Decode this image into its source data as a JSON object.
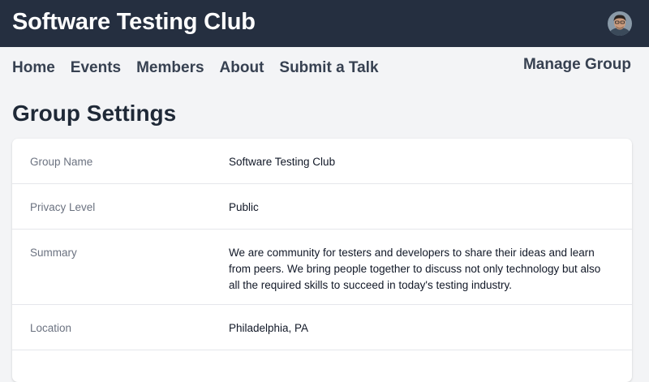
{
  "header": {
    "title": "Software Testing Club",
    "avatar_icon": "user-avatar",
    "background_color": "#252f40"
  },
  "nav": {
    "items": [
      {
        "label": "Home"
      },
      {
        "label": "Events"
      },
      {
        "label": "Members"
      },
      {
        "label": "About"
      },
      {
        "label": "Submit a Talk"
      }
    ],
    "manage_label": "Manage Group"
  },
  "page": {
    "title": "Group Settings"
  },
  "settings": {
    "rows": [
      {
        "label": "Group Name",
        "value": "Software Testing Club"
      },
      {
        "label": "Privacy Level",
        "value": "Public"
      },
      {
        "label": "Summary",
        "value": "We are community for testers and developers to share their ideas and learn from peers. We bring people together to discuss not only technology but also all the required skills to succeed in today's testing industry."
      },
      {
        "label": "Location",
        "value": "Philadelphia, PA"
      }
    ]
  }
}
